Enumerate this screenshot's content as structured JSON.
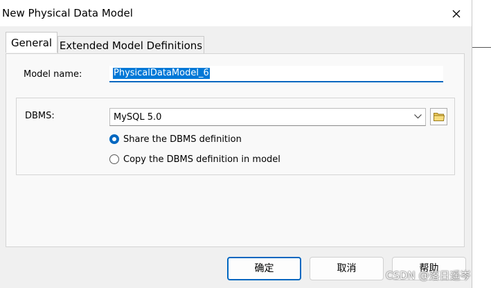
{
  "window": {
    "title": "New Physical Data Model"
  },
  "tabs": [
    {
      "label": "General",
      "active": true
    },
    {
      "label": "Extended Model Definitions",
      "active": false
    }
  ],
  "model_name": {
    "label": "Model name:",
    "value": "PhysicalDataModel_6"
  },
  "dbms": {
    "label": "DBMS:",
    "selected": "MySQL 5.0",
    "options": [
      {
        "label": "Share the DBMS definition",
        "checked": true
      },
      {
        "label": "Copy the DBMS definition in model",
        "checked": false
      }
    ]
  },
  "buttons": {
    "ok": "确定",
    "cancel": "取消",
    "help": "帮助"
  },
  "watermark": "CSDN @落日遥岑",
  "colors": {
    "accent": "#0067c0",
    "selection": "#0078d7",
    "dialog_bg": "#f0f0f0"
  }
}
